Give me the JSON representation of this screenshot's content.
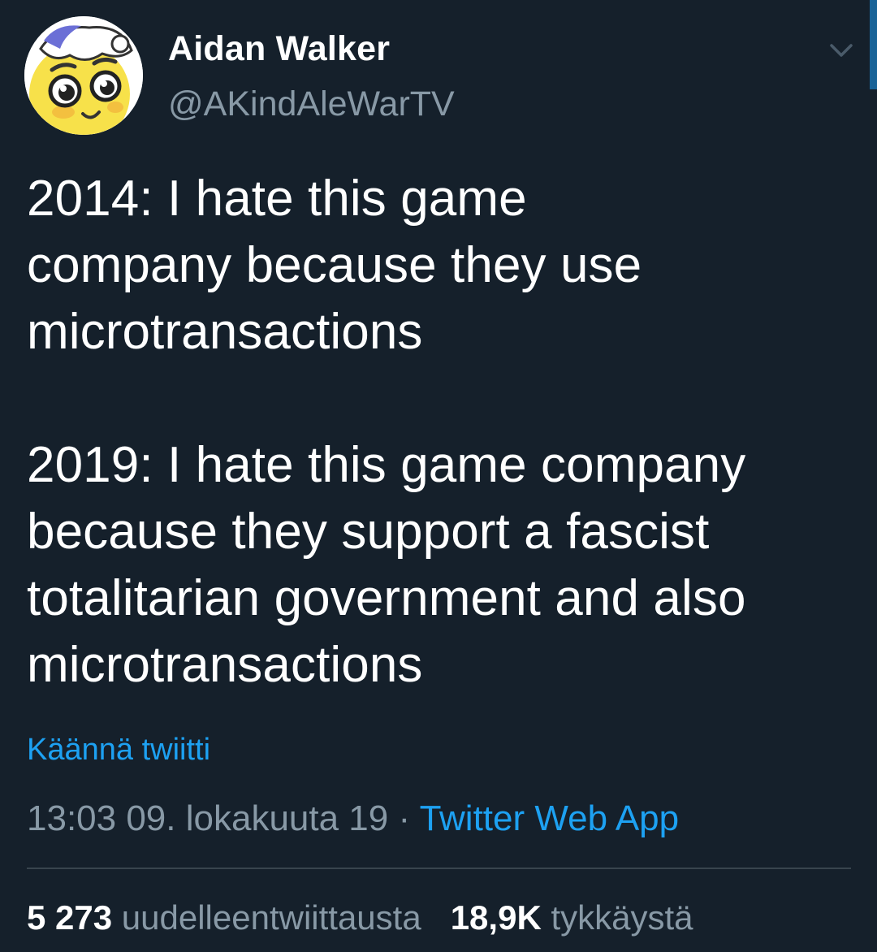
{
  "author": {
    "name": "Aidan Walker",
    "handle": "@AKindAleWarTV"
  },
  "tweet": {
    "text": "2014: I hate this game\ncompany because they use\nmicrotransactions\n\n2019: I hate this game company\nbecause they support a fascist\ntotalitarian government and also\nmicrotransactions"
  },
  "translate_label": "Käännä twiitti",
  "meta": {
    "timestamp": "13:03 09. lokakuuta 19",
    "separator": " · ",
    "source": "Twitter Web App"
  },
  "stats": {
    "retweets_count": "5 273",
    "retweets_label": "uudelleentwiittausta",
    "likes_count": "18,9K",
    "likes_label": "tykkäystä"
  },
  "colors": {
    "background": "#15202b",
    "text": "#ffffff",
    "muted": "#8899a6",
    "link": "#1da1f2",
    "divider": "#38444d"
  },
  "icons": {
    "menu": "chevron-down-icon",
    "avatar": "cartoon-character-avatar"
  }
}
